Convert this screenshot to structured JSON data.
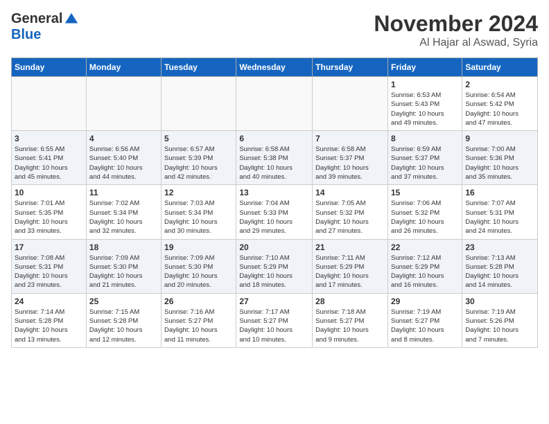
{
  "logo": {
    "general": "General",
    "blue": "Blue"
  },
  "header": {
    "month": "November 2024",
    "location": "Al Hajar al Aswad, Syria"
  },
  "weekdays": [
    "Sunday",
    "Monday",
    "Tuesday",
    "Wednesday",
    "Thursday",
    "Friday",
    "Saturday"
  ],
  "weeks": [
    [
      {
        "day": "",
        "info": ""
      },
      {
        "day": "",
        "info": ""
      },
      {
        "day": "",
        "info": ""
      },
      {
        "day": "",
        "info": ""
      },
      {
        "day": "",
        "info": ""
      },
      {
        "day": "1",
        "info": "Sunrise: 6:53 AM\nSunset: 5:43 PM\nDaylight: 10 hours\nand 49 minutes."
      },
      {
        "day": "2",
        "info": "Sunrise: 6:54 AM\nSunset: 5:42 PM\nDaylight: 10 hours\nand 47 minutes."
      }
    ],
    [
      {
        "day": "3",
        "info": "Sunrise: 6:55 AM\nSunset: 5:41 PM\nDaylight: 10 hours\nand 45 minutes."
      },
      {
        "day": "4",
        "info": "Sunrise: 6:56 AM\nSunset: 5:40 PM\nDaylight: 10 hours\nand 44 minutes."
      },
      {
        "day": "5",
        "info": "Sunrise: 6:57 AM\nSunset: 5:39 PM\nDaylight: 10 hours\nand 42 minutes."
      },
      {
        "day": "6",
        "info": "Sunrise: 6:58 AM\nSunset: 5:38 PM\nDaylight: 10 hours\nand 40 minutes."
      },
      {
        "day": "7",
        "info": "Sunrise: 6:58 AM\nSunset: 5:37 PM\nDaylight: 10 hours\nand 39 minutes."
      },
      {
        "day": "8",
        "info": "Sunrise: 6:59 AM\nSunset: 5:37 PM\nDaylight: 10 hours\nand 37 minutes."
      },
      {
        "day": "9",
        "info": "Sunrise: 7:00 AM\nSunset: 5:36 PM\nDaylight: 10 hours\nand 35 minutes."
      }
    ],
    [
      {
        "day": "10",
        "info": "Sunrise: 7:01 AM\nSunset: 5:35 PM\nDaylight: 10 hours\nand 33 minutes."
      },
      {
        "day": "11",
        "info": "Sunrise: 7:02 AM\nSunset: 5:34 PM\nDaylight: 10 hours\nand 32 minutes."
      },
      {
        "day": "12",
        "info": "Sunrise: 7:03 AM\nSunset: 5:34 PM\nDaylight: 10 hours\nand 30 minutes."
      },
      {
        "day": "13",
        "info": "Sunrise: 7:04 AM\nSunset: 5:33 PM\nDaylight: 10 hours\nand 29 minutes."
      },
      {
        "day": "14",
        "info": "Sunrise: 7:05 AM\nSunset: 5:32 PM\nDaylight: 10 hours\nand 27 minutes."
      },
      {
        "day": "15",
        "info": "Sunrise: 7:06 AM\nSunset: 5:32 PM\nDaylight: 10 hours\nand 26 minutes."
      },
      {
        "day": "16",
        "info": "Sunrise: 7:07 AM\nSunset: 5:31 PM\nDaylight: 10 hours\nand 24 minutes."
      }
    ],
    [
      {
        "day": "17",
        "info": "Sunrise: 7:08 AM\nSunset: 5:31 PM\nDaylight: 10 hours\nand 23 minutes."
      },
      {
        "day": "18",
        "info": "Sunrise: 7:09 AM\nSunset: 5:30 PM\nDaylight: 10 hours\nand 21 minutes."
      },
      {
        "day": "19",
        "info": "Sunrise: 7:09 AM\nSunset: 5:30 PM\nDaylight: 10 hours\nand 20 minutes."
      },
      {
        "day": "20",
        "info": "Sunrise: 7:10 AM\nSunset: 5:29 PM\nDaylight: 10 hours\nand 18 minutes."
      },
      {
        "day": "21",
        "info": "Sunrise: 7:11 AM\nSunset: 5:29 PM\nDaylight: 10 hours\nand 17 minutes."
      },
      {
        "day": "22",
        "info": "Sunrise: 7:12 AM\nSunset: 5:29 PM\nDaylight: 10 hours\nand 16 minutes."
      },
      {
        "day": "23",
        "info": "Sunrise: 7:13 AM\nSunset: 5:28 PM\nDaylight: 10 hours\nand 14 minutes."
      }
    ],
    [
      {
        "day": "24",
        "info": "Sunrise: 7:14 AM\nSunset: 5:28 PM\nDaylight: 10 hours\nand 13 minutes."
      },
      {
        "day": "25",
        "info": "Sunrise: 7:15 AM\nSunset: 5:28 PM\nDaylight: 10 hours\nand 12 minutes."
      },
      {
        "day": "26",
        "info": "Sunrise: 7:16 AM\nSunset: 5:27 PM\nDaylight: 10 hours\nand 11 minutes."
      },
      {
        "day": "27",
        "info": "Sunrise: 7:17 AM\nSunset: 5:27 PM\nDaylight: 10 hours\nand 10 minutes."
      },
      {
        "day": "28",
        "info": "Sunrise: 7:18 AM\nSunset: 5:27 PM\nDaylight: 10 hours\nand 9 minutes."
      },
      {
        "day": "29",
        "info": "Sunrise: 7:19 AM\nSunset: 5:27 PM\nDaylight: 10 hours\nand 8 minutes."
      },
      {
        "day": "30",
        "info": "Sunrise: 7:19 AM\nSunset: 5:26 PM\nDaylight: 10 hours\nand 7 minutes."
      }
    ]
  ]
}
